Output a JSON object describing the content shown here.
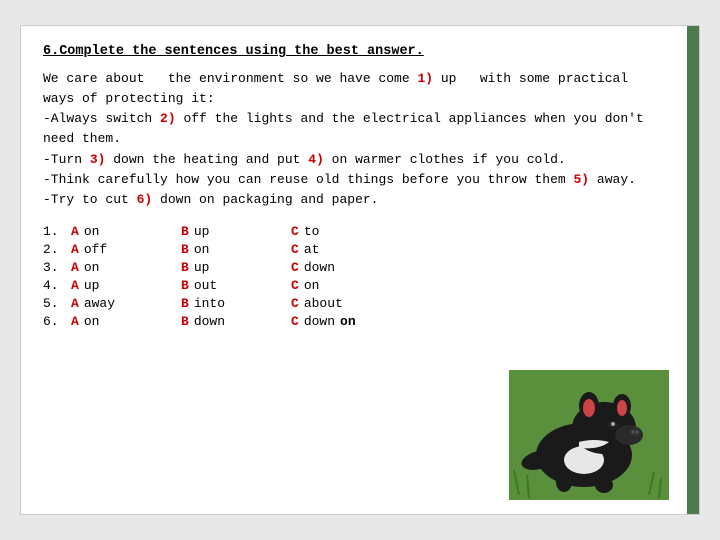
{
  "slide": {
    "title": "6.Complete the sentences using the best answer.",
    "paragraph_lines": [
      "We care about  the environment so we have come 1) up  with some practical",
      "ways of protecting it:",
      "-Always switch 2) off the lights and the electrical appliances when you don't",
      "need them.",
      "-Turn 3) down the heating and put 4) on warmer clothes if you cold.",
      "-Think carefully how you can reuse old things before you throw them 5) away.",
      "-Try to cut 6) down on packaging and paper."
    ],
    "answers": [
      {
        "num": "1.",
        "a_letter": "A",
        "a_word": "on",
        "b_letter": "B",
        "b_word": "up",
        "c_letter": "C",
        "c_word": "to"
      },
      {
        "num": "2.",
        "a_letter": "A",
        "a_word": "off",
        "b_letter": "B",
        "b_word": "on",
        "c_letter": "C",
        "c_word": "at"
      },
      {
        "num": "3.",
        "a_letter": "A",
        "a_word": "on",
        "b_letter": "B",
        "b_word": "up",
        "c_letter": "C",
        "c_word": "down"
      },
      {
        "num": "4.",
        "a_letter": "A",
        "a_word": "up",
        "b_letter": "B",
        "b_word": "out",
        "c_letter": "C",
        "c_word": "on"
      },
      {
        "num": "5.",
        "a_letter": "A",
        "a_word": "away",
        "b_letter": "B",
        "b_word": "into",
        "c_letter": "C",
        "c_word": "about"
      },
      {
        "num": "6.",
        "a_letter": "A",
        "a_word": "on",
        "b_letter": "B",
        "b_word": "down",
        "c_letter": "C",
        "c_word": "down on"
      }
    ],
    "numbered_highlights": [
      "1)",
      "2)",
      "3)",
      "4)",
      "5)",
      "6)"
    ]
  }
}
